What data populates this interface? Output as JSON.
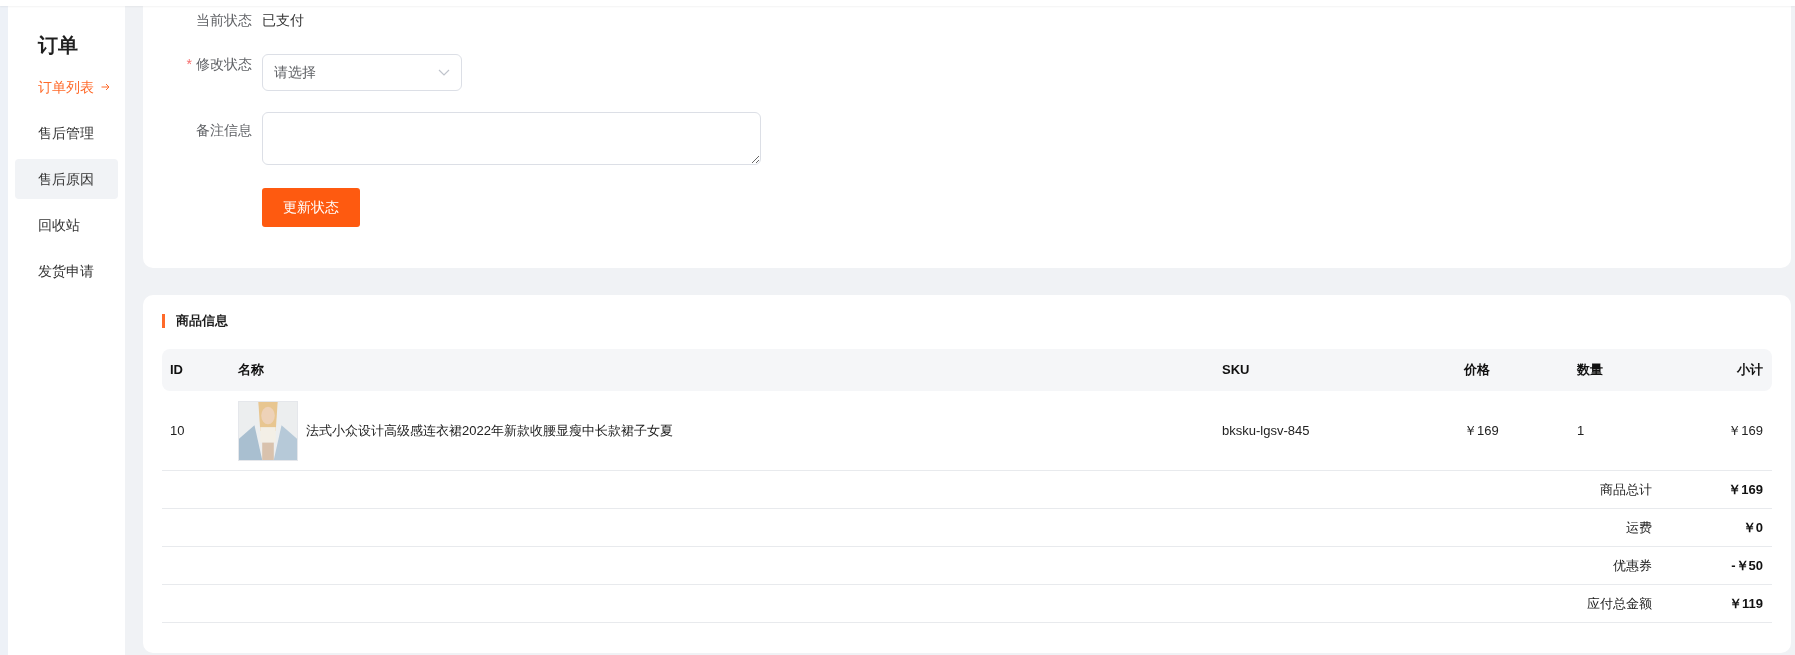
{
  "sidebar": {
    "title": "订单",
    "items": [
      {
        "label": "订单列表",
        "selected": true,
        "hovered": false
      },
      {
        "label": "售后管理",
        "selected": false,
        "hovered": false
      },
      {
        "label": "售后原因",
        "selected": false,
        "hovered": true
      },
      {
        "label": "回收站",
        "selected": false,
        "hovered": false
      },
      {
        "label": "发货申请",
        "selected": false,
        "hovered": false
      }
    ]
  },
  "status_form": {
    "fields": [
      {
        "kind": "text",
        "label": "当前状态",
        "value": "已支付"
      },
      {
        "kind": "select",
        "label": "修改状态",
        "marker": "*",
        "placeholder": "请选择"
      },
      {
        "kind": "textarea",
        "label": "备注信息"
      }
    ],
    "submit": "更新状态"
  },
  "goods": {
    "title": "商品信息",
    "table": {
      "columns": [
        "ID",
        "名称",
        "SKU",
        "价格",
        "数量",
        "小计"
      ],
      "rows": [
        {
          "id": "10",
          "name": "法式小众设计高级感连衣裙2022年新款收腰显瘦中长款裙子女夏",
          "sku": "bksku-lgsv-845",
          "price": "￥169",
          "quantity": "1",
          "subtotal": "￥169"
        }
      ]
    },
    "summary": [
      {
        "label": "商品总计",
        "value": "￥169"
      },
      {
        "label": "运费",
        "value": "￥0"
      },
      {
        "label": "优惠券",
        "value": "-￥50"
      },
      {
        "label": "应付总金额",
        "value": "￥119"
      }
    ]
  }
}
